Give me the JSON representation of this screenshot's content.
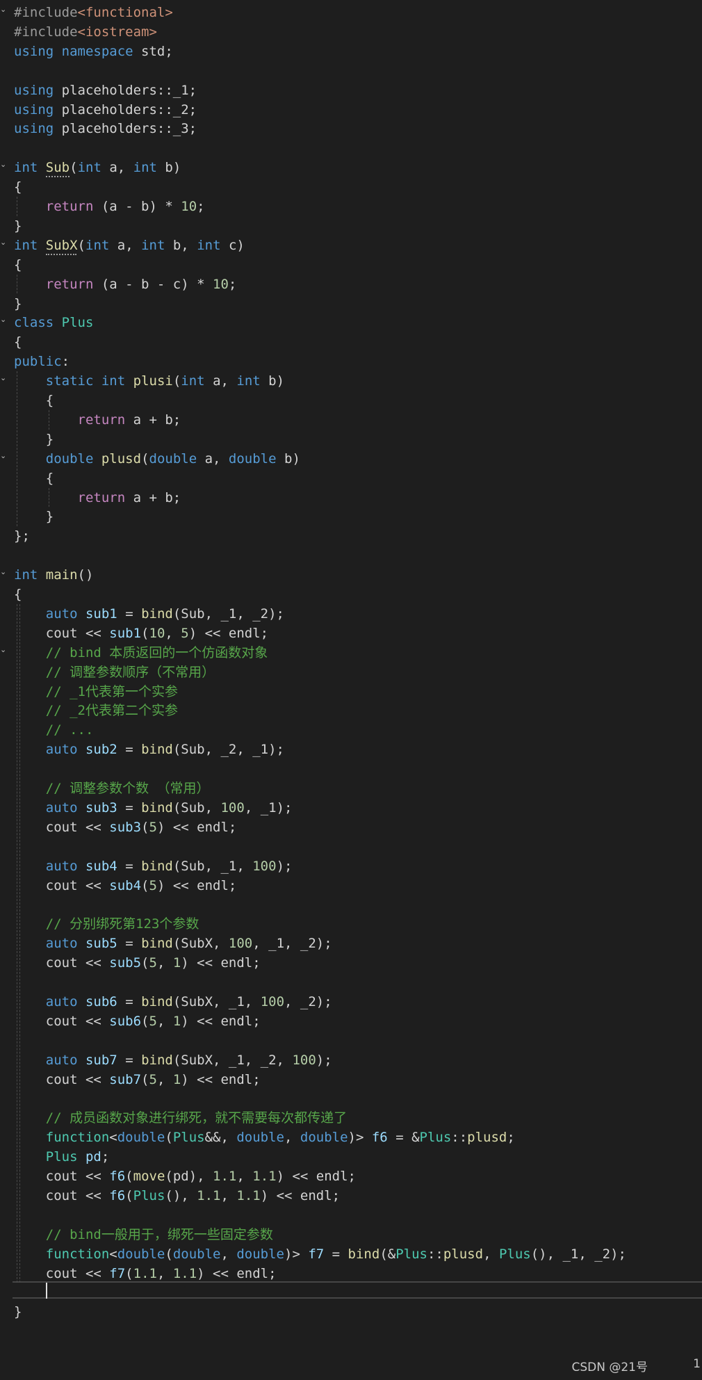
{
  "colors": {
    "background": "#1e1e1e",
    "keyword": "#569cd6",
    "control": "#c586c0",
    "type": "#4ec9b0",
    "function": "#dcdcaa",
    "variable": "#9cdcfe",
    "string": "#ce9178",
    "number": "#b5cea8",
    "comment": "#57a64a",
    "preprocessor": "#9b9b9b",
    "plain": "#d4d4d4",
    "operator": "#b4b4b4"
  },
  "code_lines": [
    [
      [
        "#include",
        "preprocessor"
      ],
      [
        "<functional>",
        "string"
      ]
    ],
    [
      [
        "#include",
        "preprocessor"
      ],
      [
        "<iostream>",
        "string"
      ]
    ],
    [
      [
        "using",
        "keyword"
      ],
      [
        " ",
        "plain"
      ],
      [
        "namespace",
        "keyword"
      ],
      [
        " std;",
        "plain"
      ]
    ],
    [],
    [
      [
        "using",
        "keyword"
      ],
      [
        " placeholders::_1;",
        "plain"
      ]
    ],
    [
      [
        "using",
        "keyword"
      ],
      [
        " placeholders::_2;",
        "plain"
      ]
    ],
    [
      [
        "using",
        "keyword"
      ],
      [
        " placeholders::_3;",
        "plain"
      ]
    ],
    [],
    [
      [
        "int",
        "keyword"
      ],
      [
        " ",
        "plain"
      ],
      [
        "Sub",
        "function"
      ],
      [
        "(",
        "plain"
      ],
      [
        "int",
        "keyword"
      ],
      [
        " a, ",
        "plain"
      ],
      [
        "int",
        "keyword"
      ],
      [
        " b)",
        "plain"
      ]
    ],
    [
      [
        "{",
        "plain"
      ]
    ],
    [
      [
        "    ",
        "plain"
      ],
      [
        "return",
        "control"
      ],
      [
        " (a - b) * ",
        "plain"
      ],
      [
        "10",
        "number"
      ],
      [
        ";",
        "plain"
      ]
    ],
    [
      [
        "}",
        "plain"
      ]
    ],
    [
      [
        "int",
        "keyword"
      ],
      [
        " ",
        "plain"
      ],
      [
        "SubX",
        "function"
      ],
      [
        "(",
        "plain"
      ],
      [
        "int",
        "keyword"
      ],
      [
        " a, ",
        "plain"
      ],
      [
        "int",
        "keyword"
      ],
      [
        " b, ",
        "plain"
      ],
      [
        "int",
        "keyword"
      ],
      [
        " c)",
        "plain"
      ]
    ],
    [
      [
        "{",
        "plain"
      ]
    ],
    [
      [
        "    ",
        "plain"
      ],
      [
        "return",
        "control"
      ],
      [
        " (a - b - c) * ",
        "plain"
      ],
      [
        "10",
        "number"
      ],
      [
        ";",
        "plain"
      ]
    ],
    [
      [
        "}",
        "plain"
      ]
    ],
    [
      [
        "class",
        "keyword"
      ],
      [
        " ",
        "plain"
      ],
      [
        "Plus",
        "type"
      ]
    ],
    [
      [
        "{",
        "plain"
      ]
    ],
    [
      [
        "public",
        "keyword"
      ],
      [
        ":",
        "plain"
      ]
    ],
    [
      [
        "    ",
        "plain"
      ],
      [
        "static",
        "keyword"
      ],
      [
        " ",
        "plain"
      ],
      [
        "int",
        "keyword"
      ],
      [
        " ",
        "plain"
      ],
      [
        "plusi",
        "function"
      ],
      [
        "(",
        "plain"
      ],
      [
        "int",
        "keyword"
      ],
      [
        " a, ",
        "plain"
      ],
      [
        "int",
        "keyword"
      ],
      [
        " b)",
        "plain"
      ]
    ],
    [
      [
        "    {",
        "plain"
      ]
    ],
    [
      [
        "        ",
        "plain"
      ],
      [
        "return",
        "control"
      ],
      [
        " a + b;",
        "plain"
      ]
    ],
    [
      [
        "    }",
        "plain"
      ]
    ],
    [
      [
        "    ",
        "plain"
      ],
      [
        "double",
        "keyword"
      ],
      [
        " ",
        "plain"
      ],
      [
        "plusd",
        "function"
      ],
      [
        "(",
        "plain"
      ],
      [
        "double",
        "keyword"
      ],
      [
        " a, ",
        "plain"
      ],
      [
        "double",
        "keyword"
      ],
      [
        " b)",
        "plain"
      ]
    ],
    [
      [
        "    {",
        "plain"
      ]
    ],
    [
      [
        "        ",
        "plain"
      ],
      [
        "return",
        "control"
      ],
      [
        " a + b;",
        "plain"
      ]
    ],
    [
      [
        "    }",
        "plain"
      ]
    ],
    [
      [
        "};",
        "plain"
      ]
    ],
    [],
    [
      [
        "int",
        "keyword"
      ],
      [
        " ",
        "plain"
      ],
      [
        "main",
        "function"
      ],
      [
        "()",
        "plain"
      ]
    ],
    [
      [
        "{",
        "plain"
      ]
    ],
    [
      [
        "    ",
        "plain"
      ],
      [
        "auto",
        "keyword"
      ],
      [
        " ",
        "plain"
      ],
      [
        "sub1",
        "variable"
      ],
      [
        " = ",
        "plain"
      ],
      [
        "bind",
        "function"
      ],
      [
        "(Sub, _1, _2);",
        "plain"
      ]
    ],
    [
      [
        "    cout << ",
        "plain"
      ],
      [
        "sub1",
        "variable"
      ],
      [
        "(",
        "plain"
      ],
      [
        "10",
        "number"
      ],
      [
        ", ",
        "plain"
      ],
      [
        "5",
        "number"
      ],
      [
        ") << endl;",
        "plain"
      ]
    ],
    [
      [
        "    ",
        "plain"
      ],
      [
        "// bind 本质返回的一个仿函数对象",
        "comment"
      ]
    ],
    [
      [
        "    ",
        "plain"
      ],
      [
        "// 调整参数顺序（不常用）",
        "comment"
      ]
    ],
    [
      [
        "    ",
        "plain"
      ],
      [
        "// _1代表第一个实参",
        "comment"
      ]
    ],
    [
      [
        "    ",
        "plain"
      ],
      [
        "// _2代表第二个实参",
        "comment"
      ]
    ],
    [
      [
        "    ",
        "plain"
      ],
      [
        "// ...",
        "comment"
      ]
    ],
    [
      [
        "    ",
        "plain"
      ],
      [
        "auto",
        "keyword"
      ],
      [
        " ",
        "plain"
      ],
      [
        "sub2",
        "variable"
      ],
      [
        " = ",
        "plain"
      ],
      [
        "bind",
        "function"
      ],
      [
        "(Sub, _2, _1);",
        "plain"
      ]
    ],
    [],
    [
      [
        "    ",
        "plain"
      ],
      [
        "// 调整参数个数 （常用）",
        "comment"
      ]
    ],
    [
      [
        "    ",
        "plain"
      ],
      [
        "auto",
        "keyword"
      ],
      [
        " ",
        "plain"
      ],
      [
        "sub3",
        "variable"
      ],
      [
        " = ",
        "plain"
      ],
      [
        "bind",
        "function"
      ],
      [
        "(Sub, ",
        "plain"
      ],
      [
        "100",
        "number"
      ],
      [
        ", _1);",
        "plain"
      ]
    ],
    [
      [
        "    cout << ",
        "plain"
      ],
      [
        "sub3",
        "variable"
      ],
      [
        "(",
        "plain"
      ],
      [
        "5",
        "number"
      ],
      [
        ") << endl;",
        "plain"
      ]
    ],
    [],
    [
      [
        "    ",
        "plain"
      ],
      [
        "auto",
        "keyword"
      ],
      [
        " ",
        "plain"
      ],
      [
        "sub4",
        "variable"
      ],
      [
        " = ",
        "plain"
      ],
      [
        "bind",
        "function"
      ],
      [
        "(Sub, _1, ",
        "plain"
      ],
      [
        "100",
        "number"
      ],
      [
        ");",
        "plain"
      ]
    ],
    [
      [
        "    cout << ",
        "plain"
      ],
      [
        "sub4",
        "variable"
      ],
      [
        "(",
        "plain"
      ],
      [
        "5",
        "number"
      ],
      [
        ") << endl;",
        "plain"
      ]
    ],
    [],
    [
      [
        "    ",
        "plain"
      ],
      [
        "// 分别绑死第123个参数",
        "comment"
      ]
    ],
    [
      [
        "    ",
        "plain"
      ],
      [
        "auto",
        "keyword"
      ],
      [
        " ",
        "plain"
      ],
      [
        "sub5",
        "variable"
      ],
      [
        " = ",
        "plain"
      ],
      [
        "bind",
        "function"
      ],
      [
        "(SubX, ",
        "plain"
      ],
      [
        "100",
        "number"
      ],
      [
        ", _1, _2);",
        "plain"
      ]
    ],
    [
      [
        "    cout << ",
        "plain"
      ],
      [
        "sub5",
        "variable"
      ],
      [
        "(",
        "plain"
      ],
      [
        "5",
        "number"
      ],
      [
        ", ",
        "plain"
      ],
      [
        "1",
        "number"
      ],
      [
        ") << endl;",
        "plain"
      ]
    ],
    [],
    [
      [
        "    ",
        "plain"
      ],
      [
        "auto",
        "keyword"
      ],
      [
        " ",
        "plain"
      ],
      [
        "sub6",
        "variable"
      ],
      [
        " = ",
        "plain"
      ],
      [
        "bind",
        "function"
      ],
      [
        "(SubX, _1, ",
        "plain"
      ],
      [
        "100",
        "number"
      ],
      [
        ", _2);",
        "plain"
      ]
    ],
    [
      [
        "    cout << ",
        "plain"
      ],
      [
        "sub6",
        "variable"
      ],
      [
        "(",
        "plain"
      ],
      [
        "5",
        "number"
      ],
      [
        ", ",
        "plain"
      ],
      [
        "1",
        "number"
      ],
      [
        ") << endl;",
        "plain"
      ]
    ],
    [],
    [
      [
        "    ",
        "plain"
      ],
      [
        "auto",
        "keyword"
      ],
      [
        " ",
        "plain"
      ],
      [
        "sub7",
        "variable"
      ],
      [
        " = ",
        "plain"
      ],
      [
        "bind",
        "function"
      ],
      [
        "(SubX, _1, _2, ",
        "plain"
      ],
      [
        "100",
        "number"
      ],
      [
        ");",
        "plain"
      ]
    ],
    [
      [
        "    cout << ",
        "plain"
      ],
      [
        "sub7",
        "variable"
      ],
      [
        "(",
        "plain"
      ],
      [
        "5",
        "number"
      ],
      [
        ", ",
        "plain"
      ],
      [
        "1",
        "number"
      ],
      [
        ") << endl;",
        "plain"
      ]
    ],
    [],
    [
      [
        "    ",
        "plain"
      ],
      [
        "// 成员函数对象进行绑死，就不需要每次都传递了",
        "comment"
      ]
    ],
    [
      [
        "    ",
        "plain"
      ],
      [
        "function",
        "type"
      ],
      [
        "<",
        "plain"
      ],
      [
        "double",
        "keyword"
      ],
      [
        "(",
        "plain"
      ],
      [
        "Plus",
        "type"
      ],
      [
        "&&, ",
        "plain"
      ],
      [
        "double",
        "keyword"
      ],
      [
        ", ",
        "plain"
      ],
      [
        "double",
        "keyword"
      ],
      [
        ")> ",
        "plain"
      ],
      [
        "f6",
        "variable"
      ],
      [
        " = &",
        "plain"
      ],
      [
        "Plus",
        "type"
      ],
      [
        "::",
        "plain"
      ],
      [
        "plusd",
        "function"
      ],
      [
        ";",
        "plain"
      ]
    ],
    [
      [
        "    ",
        "plain"
      ],
      [
        "Plus",
        "type"
      ],
      [
        " ",
        "plain"
      ],
      [
        "pd",
        "variable"
      ],
      [
        ";",
        "plain"
      ]
    ],
    [
      [
        "    cout << ",
        "plain"
      ],
      [
        "f6",
        "variable"
      ],
      [
        "(",
        "plain"
      ],
      [
        "move",
        "function"
      ],
      [
        "(pd), ",
        "plain"
      ],
      [
        "1.1",
        "number"
      ],
      [
        ", ",
        "plain"
      ],
      [
        "1.1",
        "number"
      ],
      [
        ") << endl;",
        "plain"
      ]
    ],
    [
      [
        "    cout << ",
        "plain"
      ],
      [
        "f6",
        "variable"
      ],
      [
        "(",
        "plain"
      ],
      [
        "Plus",
        "type"
      ],
      [
        "(), ",
        "plain"
      ],
      [
        "1.1",
        "number"
      ],
      [
        ", ",
        "plain"
      ],
      [
        "1.1",
        "number"
      ],
      [
        ") << endl;",
        "plain"
      ]
    ],
    [],
    [
      [
        "    ",
        "plain"
      ],
      [
        "// bind一般用于，绑死一些固定参数",
        "comment"
      ]
    ],
    [
      [
        "    ",
        "plain"
      ],
      [
        "function",
        "type"
      ],
      [
        "<",
        "plain"
      ],
      [
        "double",
        "keyword"
      ],
      [
        "(",
        "plain"
      ],
      [
        "double",
        "keyword"
      ],
      [
        ", ",
        "plain"
      ],
      [
        "double",
        "keyword"
      ],
      [
        ")> ",
        "plain"
      ],
      [
        "f7",
        "variable"
      ],
      [
        " = ",
        "plain"
      ],
      [
        "bind",
        "function"
      ],
      [
        "(&",
        "plain"
      ],
      [
        "Plus",
        "type"
      ],
      [
        "::",
        "plain"
      ],
      [
        "plusd",
        "function"
      ],
      [
        ", ",
        "plain"
      ],
      [
        "Plus",
        "type"
      ],
      [
        "(), _1, _2);",
        "plain"
      ]
    ],
    [
      [
        "    cout << ",
        "plain"
      ],
      [
        "f7",
        "variable"
      ],
      [
        "(",
        "plain"
      ],
      [
        "1.1",
        "number"
      ],
      [
        ", ",
        "plain"
      ],
      [
        "1.1",
        "number"
      ],
      [
        ") << endl;",
        "plain"
      ]
    ],
    [],
    [
      [
        "}",
        "plain"
      ]
    ]
  ],
  "watermark": "CSDN @21号",
  "corner_number": "1"
}
